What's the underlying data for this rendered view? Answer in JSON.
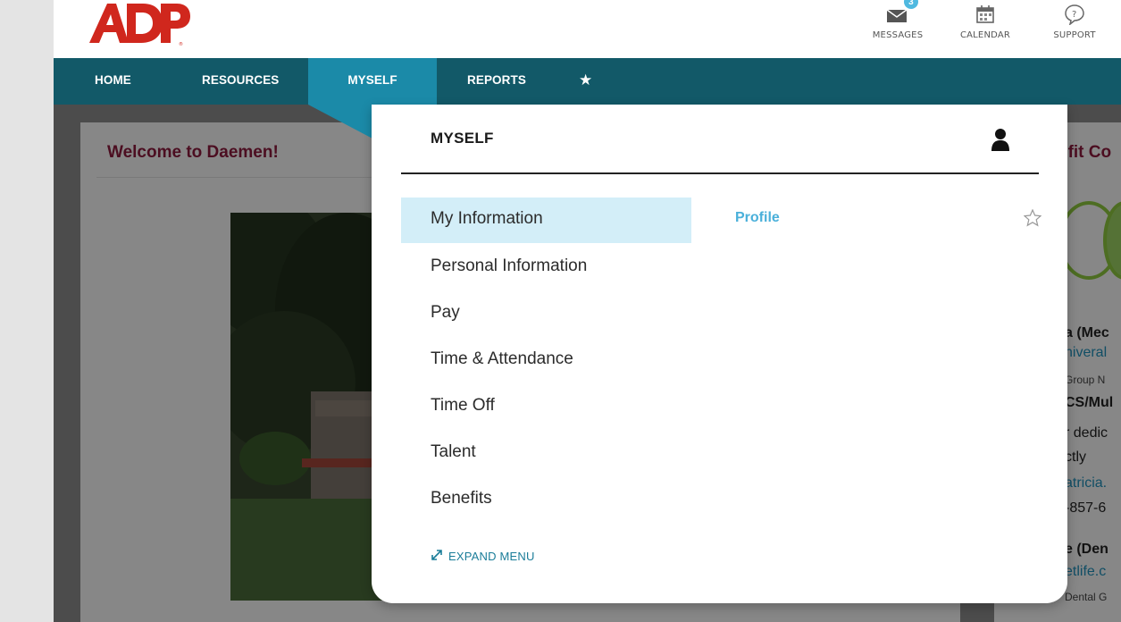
{
  "header": {
    "brand": "ADP",
    "links": [
      {
        "label": "MESSAGES",
        "badge": "3",
        "icon": "envelope-icon"
      },
      {
        "label": "CALENDAR",
        "icon": "calendar-icon"
      },
      {
        "label": "SUPPORT",
        "icon": "support-icon"
      }
    ]
  },
  "nav": {
    "items": [
      {
        "label": "HOME"
      },
      {
        "label": "RESOURCES"
      },
      {
        "label": "MYSELF",
        "active": true
      },
      {
        "label": "REPORTS"
      },
      {
        "label": "★",
        "icon": "favorites-star-icon"
      }
    ]
  },
  "background": {
    "welcome_title": "Welcome to Daemen!",
    "right_title": "efit Co",
    "right_lines": [
      "a (Mec",
      "niveral",
      "Group N",
      "CS/Mul",
      "r dedic",
      "ctly",
      "atricia.",
      "-857-6",
      "e (Den",
      "etlife.c",
      "Dental G"
    ]
  },
  "menu": {
    "title": "MYSELF",
    "items": [
      {
        "label": "My Information",
        "selected": true
      },
      {
        "label": "Personal Information"
      },
      {
        "label": "Pay"
      },
      {
        "label": "Time & Attendance"
      },
      {
        "label": "Time Off"
      },
      {
        "label": "Talent"
      },
      {
        "label": "Benefits"
      }
    ],
    "submenu": [
      {
        "label": "Profile"
      }
    ],
    "expand_label": "EXPAND MENU"
  },
  "colors": {
    "nav_bg": "#125968",
    "nav_active": "#1b8aa8",
    "brand_red": "#d0271d",
    "highlight": "#d3eef8",
    "link_blue": "#4ab0da",
    "title_maroon": "#8a1b3c"
  }
}
